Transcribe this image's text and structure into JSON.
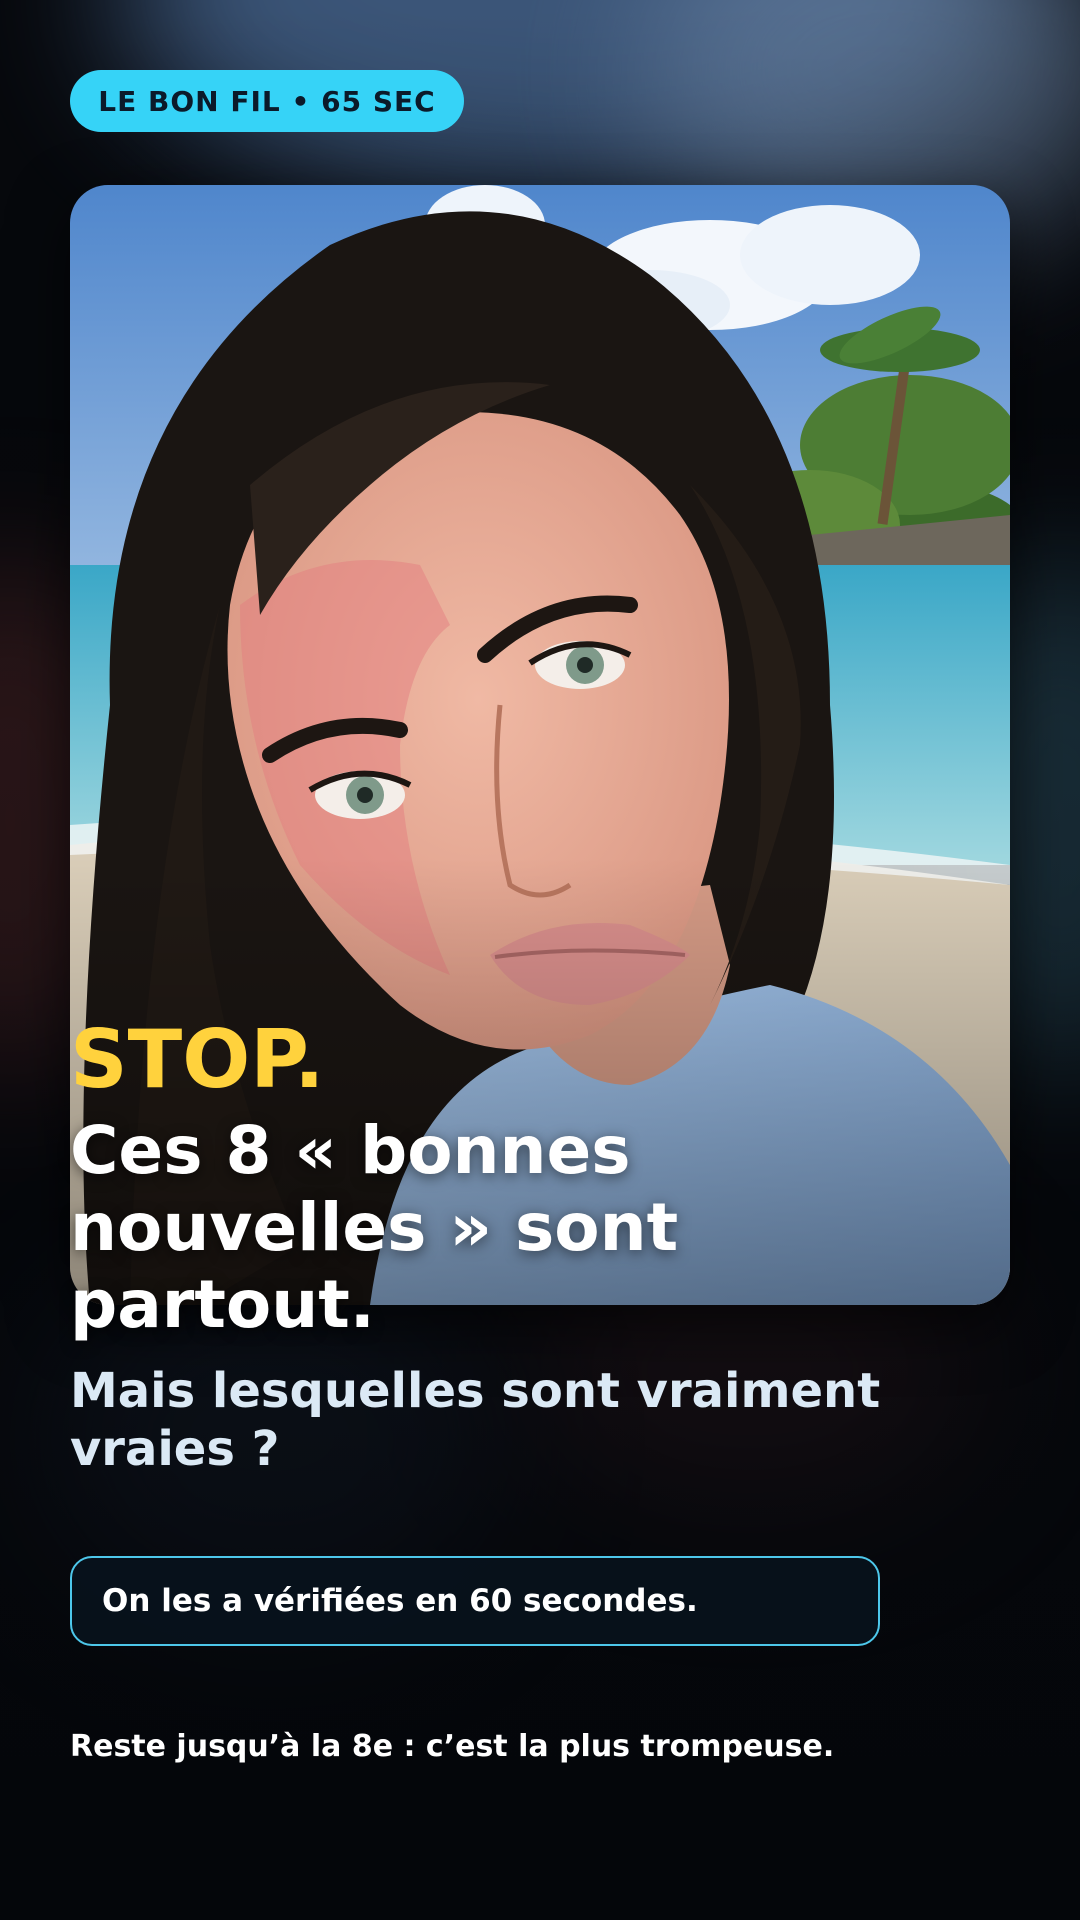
{
  "badge": {
    "text": "LE BON FIL • 65 SEC"
  },
  "headline": {
    "stop": "STOP.",
    "main": "Ces 8 « bonnes nouvelles » sont partout.",
    "sub": "Mais lesquelles sont vraiment vraies ?"
  },
  "callout": {
    "text": "On les a vérifiées en 60 secondes."
  },
  "footer": {
    "text": "Reste jusqu’à la 8e : c’est la plus trompeuse."
  },
  "colors": {
    "badge_bg": "#36d3f7",
    "stop_yellow": "#ffd23d",
    "callout_border": "#4dc7ea",
    "subtitle": "#dbe9f5"
  }
}
